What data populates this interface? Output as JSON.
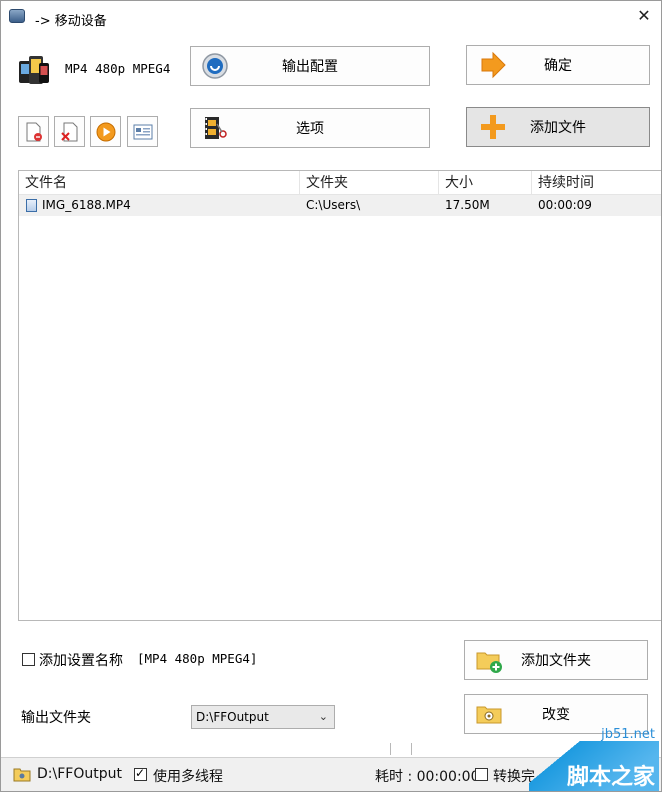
{
  "window": {
    "title": "-> 移动设备",
    "close_glyph": "✕"
  },
  "device": {
    "label": "MP4 480p MPEG4",
    "icon": "phone-devices-icon"
  },
  "buttons": {
    "output_config": "输出配置",
    "confirm": "确定",
    "options": "选项",
    "add_file": "添加文件",
    "add_folder": "添加文件夹",
    "change": "改变"
  },
  "toolbar": {
    "small_buttons": [
      "remove-file-icon",
      "delete-file-icon",
      "play-icon",
      "media-info-icon"
    ]
  },
  "file_list": {
    "columns": [
      "文件名",
      "文件夹",
      "大小",
      "持续时间"
    ],
    "rows": [
      {
        "name": "IMG_6188.MP4",
        "folder": "C:\\Users\\",
        "size": "17.50M",
        "duration": "00:00:09"
      }
    ]
  },
  "options": {
    "add_settings_name_label": "添加设置名称",
    "add_settings_name_value": "[MP4 480p MPEG4]",
    "add_settings_name_checked": false,
    "output_folder_label": "输出文件夹",
    "output_folder_value": "D:\\FFOutput"
  },
  "statusbar": {
    "path": "D:\\FFOutput",
    "multithread_label": "使用多线程",
    "multithread_checked": true,
    "elapsed": "耗时 : 00:00:00",
    "after_convert_label": "转换完"
  },
  "watermark": {
    "top": "jb51.net",
    "main": "脚本之家"
  },
  "colors": {
    "accent_orange": "#f39a1e",
    "watermark_blue": "#1e9be0"
  }
}
